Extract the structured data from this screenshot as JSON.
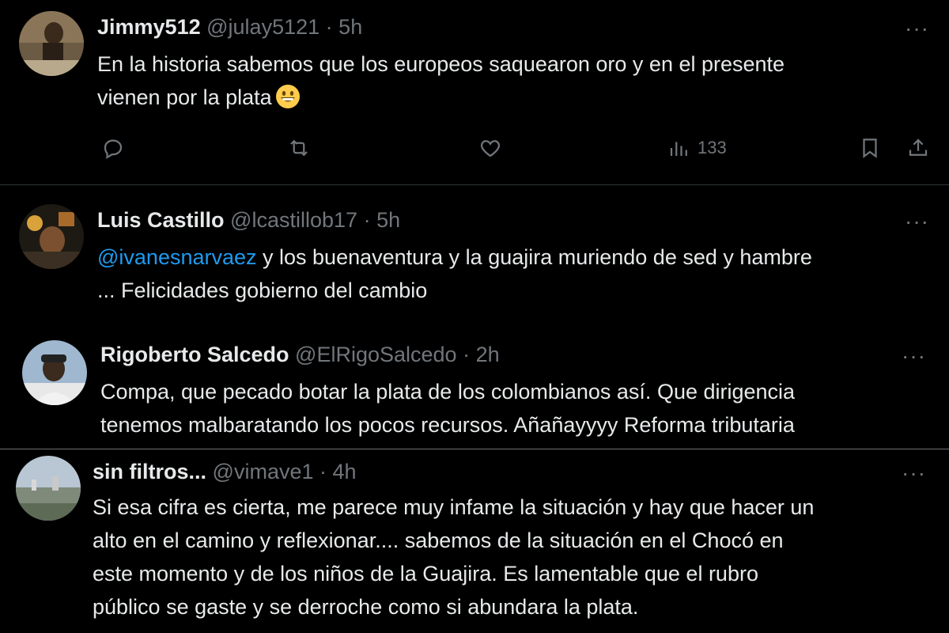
{
  "tweets": [
    {
      "name": "Jimmy512",
      "handle": "@julay5121",
      "separator": "·",
      "time": "5h",
      "more": "···",
      "lines": [
        "En la historia sabemos que los europeos saquearon oro y en el presente",
        "vienen por la plata"
      ],
      "emoji": "grinning-face-emoji",
      "views": "133"
    },
    {
      "name": "Luis Castillo",
      "handle": "@lcastillob17",
      "separator": "·",
      "time": "5h",
      "more": "···",
      "mention": "@ivanesnarvaez",
      "line1_rest": " y los buenaventura y la guajira muriendo de sed y hambre",
      "line2": "... Felicidades gobierno del cambio"
    },
    {
      "name": "Rigoberto Salcedo",
      "handle": "@ElRigoSalcedo",
      "separator": "·",
      "time": "2h",
      "more": "···",
      "lines": [
        "Compa, que pecado botar la plata de los colombianos así. Que dirigencia",
        "tenemos malbaratando los pocos recursos. Añañayyyy Reforma tributaria"
      ]
    },
    {
      "name": "sin filtros...",
      "handle": "@vimave1",
      "separator": "·",
      "time": "4h",
      "more": "···",
      "lines": [
        "Si esa cifra es cierta, me parece muy infame la situación y hay que hacer un",
        "alto en el camino y reflexionar.... sabemos de la situación en el Chocó en",
        "este momento y de los niños de la Guajira.  Es lamentable que el rubro",
        "público se gaste y se derroche como si abundara la plata."
      ]
    }
  ],
  "icons": {
    "reply": "reply-icon",
    "retweet": "retweet-icon",
    "like": "like-icon",
    "views": "views-icon",
    "bookmark": "bookmark-icon",
    "share": "share-icon"
  },
  "colors": {
    "background": "#000000",
    "text": "#e7e9ea",
    "muted": "#71767b",
    "link": "#1d9bf0",
    "divider": "#2f3336"
  }
}
